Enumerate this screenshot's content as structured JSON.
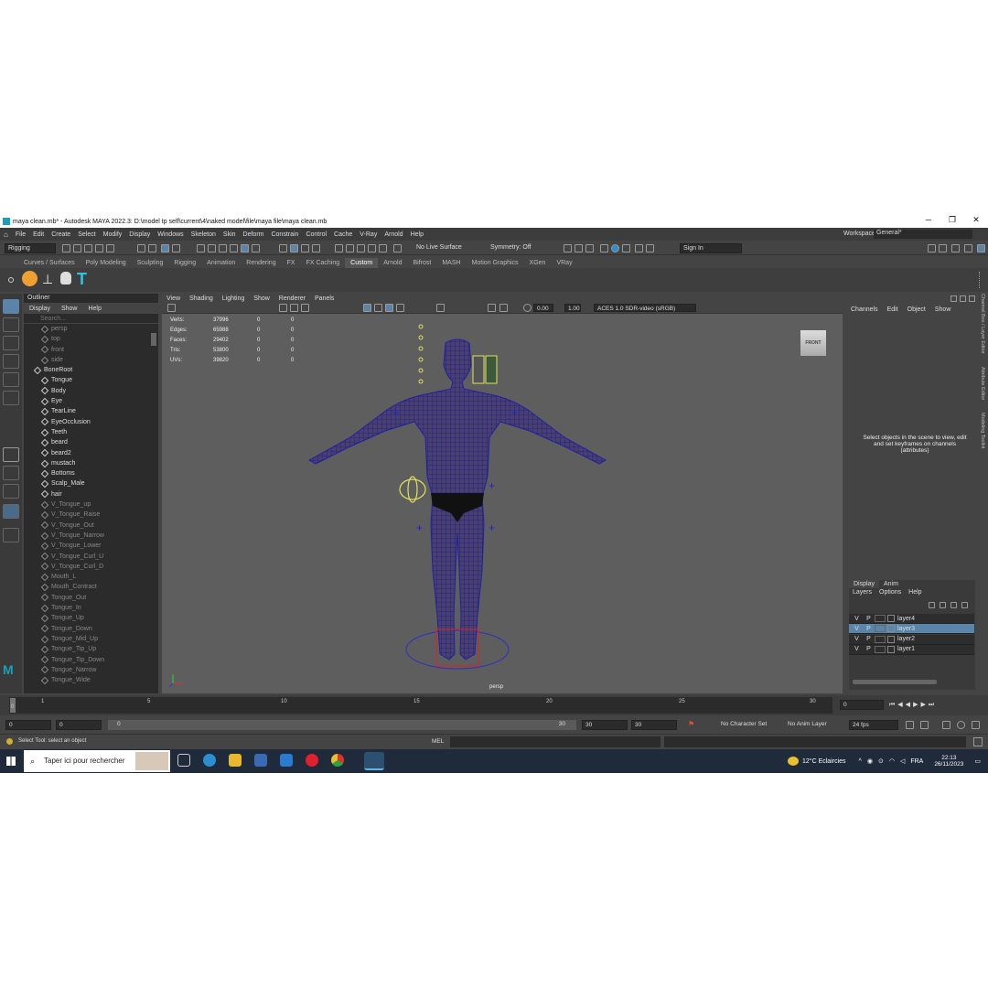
{
  "window": {
    "title": "maya clean.mb* - Autodesk MAYA 2022.3: D:\\model tp self\\current\\4\\naked model\\file\\maya file\\maya clean.mb",
    "minimize": "─",
    "maximize": "❐",
    "close": "✕"
  },
  "menubar": {
    "items": [
      "File",
      "Edit",
      "Create",
      "Select",
      "Modify",
      "Display",
      "Windows",
      "Skeleton",
      "Skin",
      "Deform",
      "Constrain",
      "Control",
      "Cache",
      "V-Ray",
      "Arnold",
      "Help"
    ],
    "workspace_label": "Workspace:",
    "workspace_value": "General*"
  },
  "statusline": {
    "menuset": "Rigging",
    "live_surface": "No Live Surface",
    "symmetry": "Symmetry: Off",
    "sign_in": "Sign In"
  },
  "shelf": {
    "tabs": [
      "Curves / Surfaces",
      "Poly Modeling",
      "Sculpting",
      "Rigging",
      "Animation",
      "Rendering",
      "FX",
      "FX Caching",
      "Custom",
      "Arnold",
      "Bifrost",
      "MASH",
      "Motion Graphics",
      "XGen",
      "VRay"
    ],
    "active_tab": "Custom"
  },
  "outliner": {
    "title": "Outliner",
    "menu": [
      "Display",
      "Show",
      "Help"
    ],
    "search_placeholder": "Search...",
    "items": [
      {
        "label": "persp",
        "dim": true
      },
      {
        "label": "top",
        "dim": true
      },
      {
        "label": "front",
        "dim": true
      },
      {
        "label": "side",
        "dim": true
      },
      {
        "label": "BoneRoot",
        "dim": false
      },
      {
        "label": "Tongue",
        "dim": false
      },
      {
        "label": "Body",
        "dim": false
      },
      {
        "label": "Eye",
        "dim": false
      },
      {
        "label": "TearLine",
        "dim": false
      },
      {
        "label": "EyeOcclusion",
        "dim": false
      },
      {
        "label": "Teeth",
        "dim": false
      },
      {
        "label": "beard",
        "dim": false
      },
      {
        "label": "beard2",
        "dim": false
      },
      {
        "label": "mustach",
        "dim": false
      },
      {
        "label": "Bottoms",
        "dim": false
      },
      {
        "label": "Scalp_Male",
        "dim": false
      },
      {
        "label": "hair",
        "dim": false
      },
      {
        "label": "V_Tongue_up",
        "dim": true
      },
      {
        "label": "V_Tongue_Raise",
        "dim": true
      },
      {
        "label": "V_Tongue_Out",
        "dim": true
      },
      {
        "label": "V_Tongue_Narrow",
        "dim": true
      },
      {
        "label": "V_Tongue_Lower",
        "dim": true
      },
      {
        "label": "V_Tongue_Curl_U",
        "dim": true
      },
      {
        "label": "V_Tongue_Curl_D",
        "dim": true
      },
      {
        "label": "Mouth_L",
        "dim": true
      },
      {
        "label": "Mouth_Contract",
        "dim": true
      },
      {
        "label": "Tongue_Out",
        "dim": true
      },
      {
        "label": "Tongue_In",
        "dim": true
      },
      {
        "label": "Tongue_Up",
        "dim": true
      },
      {
        "label": "Tongue_Down",
        "dim": true
      },
      {
        "label": "Tongue_Mid_Up",
        "dim": true
      },
      {
        "label": "Tongue_Tip_Up",
        "dim": true
      },
      {
        "label": "Tongue_Tip_Down",
        "dim": true
      },
      {
        "label": "Tongue_Narrow",
        "dim": true
      },
      {
        "label": "Tongue_Wide",
        "dim": true
      }
    ]
  },
  "viewport": {
    "menu": [
      "View",
      "Shading",
      "Lighting",
      "Show",
      "Renderer",
      "Panels"
    ],
    "exposure": "0.00",
    "gamma": "1.00",
    "colorspace": "ACES 1.0 SDR-video (sRGB)",
    "hud": [
      {
        "label": "Verts:",
        "a": "37996",
        "b": "0",
        "c": "0"
      },
      {
        "label": "Edges:",
        "a": "65988",
        "b": "0",
        "c": "0"
      },
      {
        "label": "Faces:",
        "a": "29402",
        "b": "0",
        "c": "0"
      },
      {
        "label": "Tris:",
        "a": "53800",
        "b": "0",
        "c": "0"
      },
      {
        "label": "UVs:",
        "a": "39820",
        "b": "0",
        "c": "0"
      }
    ],
    "camera_label": "persp",
    "viewcube_label": "FRONT"
  },
  "channelbox": {
    "menu": [
      "Channels",
      "Edit",
      "Object",
      "Show"
    ],
    "message": "Select objects in the scene to view, edit and set keyframes on channels (attributes)"
  },
  "layer_editor": {
    "tabs": [
      "Display",
      "Anim"
    ],
    "menu": [
      "Layers",
      "Options",
      "Help"
    ],
    "layers": [
      {
        "v": "V",
        "p": "P",
        "name": "layer4",
        "selected": false
      },
      {
        "v": "V",
        "p": "P",
        "name": "layer3",
        "selected": true
      },
      {
        "v": "V",
        "p": "P",
        "name": "layer2",
        "selected": false
      },
      {
        "v": "V",
        "p": "P",
        "name": "layer1",
        "selected": false
      }
    ]
  },
  "side_tabs": [
    "Channel Box / Layer Editor",
    "Attribute Editor",
    "Modeling Toolkit"
  ],
  "timeline": {
    "ticks": [
      "0",
      "1",
      "5",
      "10",
      "15",
      "20",
      "25",
      "30"
    ],
    "current_frame": "0"
  },
  "range": {
    "start": "0",
    "anim_start": "0",
    "slider_start": "0",
    "slider_end": "30",
    "anim_end": "30",
    "end": "30",
    "character_set": "No Character Set",
    "anim_layer": "No Anim Layer",
    "fps": "24 fps"
  },
  "helpline": {
    "message": "Select Tool: select an object",
    "mel_label": "MEL"
  },
  "taskbar": {
    "search_placeholder": "Taper ici pour rechercher",
    "weather": "12°C  Eclaircies",
    "lang": "FRA",
    "time": "22:13",
    "date": "26/11/2023"
  }
}
